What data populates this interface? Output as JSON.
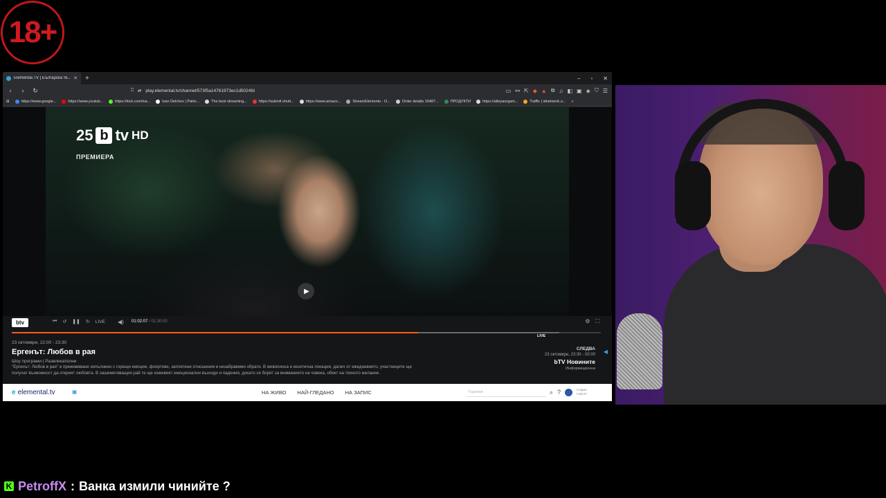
{
  "badge": {
    "text": "18+"
  },
  "browser": {
    "tab_title": "Elemental.TV | Българска те...",
    "new_tab_glyph": "+",
    "window_controls": [
      "–",
      "▫",
      "✕"
    ],
    "url": "play.elemental.tv/channel/573f5a14761973ec1d5024fd",
    "bookmarks": [
      "https://www.google...",
      "https://www.youtub...",
      "https://kick.com/iva...",
      "Ivan Delchev | Patre...",
      "The best streaming...",
      "https://submit.shutt...",
      "https://www.amazo...",
      "StreamElements - O...",
      "Order details 16487...",
      "ПРОДУКТИ",
      "https://alteyaorgani...",
      "Traffic | idnetwork.u..."
    ]
  },
  "video": {
    "channel_logo_num": "25",
    "channel_logo_b": "b",
    "channel_logo_tv": "tv",
    "channel_logo_hd": "HD",
    "premiere_label": "ПРЕМИЕРА",
    "play_glyph": "▶"
  },
  "player": {
    "small_logo": "btv",
    "live_button": "LIVE",
    "time_current": "01:02:07",
    "time_total": "/ 01:30:00",
    "progress_fraction": 0.69,
    "buffer_fraction": 0.93,
    "live_label": "LIVE",
    "program_time": "23 октомври, 22:00 - 23:30",
    "program_title": "Ергенът: Любов в рая",
    "program_genre": "Шоу програми | Развлекателни",
    "program_desc": "\"Ергенът: Любов в рая\" е преживяване изпълнено с горещи емоции, флиртове, заплетени отношения и незабравими обрати. В живописна и екзотична локация, далеч от ежедневието, участниците ще получат възможност да открият любовта. В зашеметяващия рай те ще изживеят емоционални възходи и падения, докато се борят за вниманието на човека, обект на тяхното желание.",
    "next_label": "СЛЕДВА",
    "next_time": "23 октомври, 23:30 - 00:00",
    "next_title": "bTV Новините",
    "next_info": "Информационна"
  },
  "site": {
    "logo_mark": "e",
    "logo_text": "elemental.tv",
    "nav": [
      "НА ЖИВО",
      "НАЙ-ГЛЕДАНО",
      "НА ЗАПИС"
    ],
    "search_placeholder": "Търсене",
    "user_line1": "София",
    "user_line2": "0:25:27"
  },
  "chat": {
    "platform_icon": "K",
    "username": "PetroffX",
    "separator": ":",
    "message": "Ванка измили чинийте ?"
  },
  "colors": {
    "accent": "#ff5a1f",
    "badge": "#c0181b",
    "chat_user": "#c58cf0",
    "kick": "#53fc18"
  }
}
